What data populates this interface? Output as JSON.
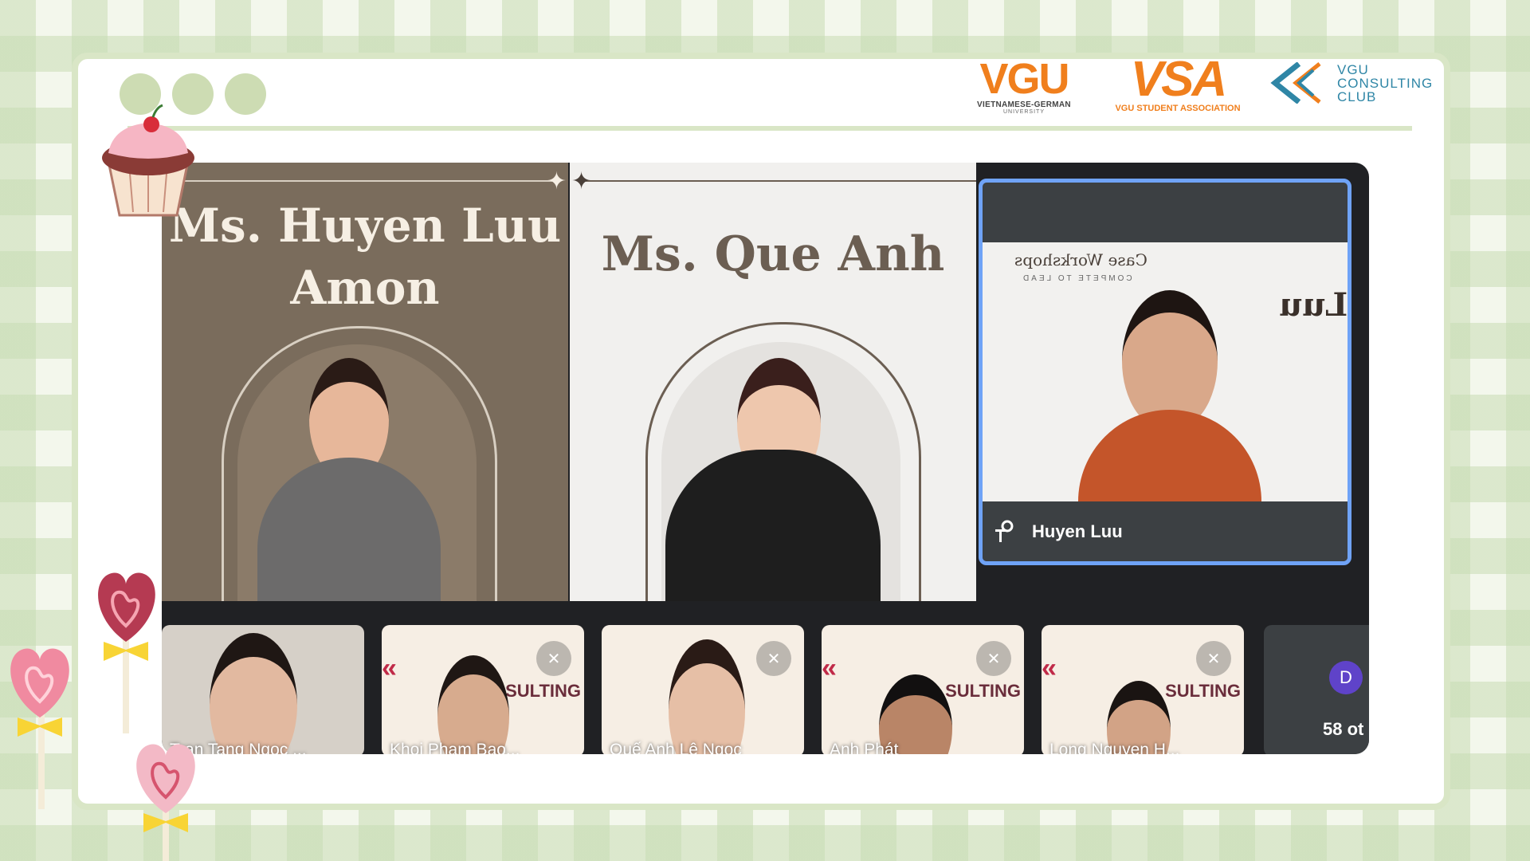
{
  "logos": {
    "vgu": {
      "mark": "VGU",
      "line1": "VIETNAMESE-GERMAN",
      "line2": "UNIVERSITY"
    },
    "vsa": {
      "mark": "VSA",
      "line1": "VGU STUDENT ASSOCIATION"
    },
    "club": {
      "line1": "VGU",
      "line2": "CONSULTING",
      "line3": "CLUB"
    }
  },
  "colors": {
    "accent_orange": "#f07f1d",
    "club_blue": "#2f86a6",
    "frame_green": "#d9e6c6",
    "highlight_blue": "#6fa3f7",
    "avatar_purple": "#5f43c9"
  },
  "speakers": [
    {
      "name_line1": "Ms. Huyen Luu",
      "name_line2": "Amon"
    },
    {
      "name_line1": "Ms. Que Anh"
    }
  ],
  "selected_tile": {
    "mirrored_text1": "Case Workshops",
    "mirrored_text2": "COMPETE TO LEAD",
    "mirrored_text3": "Luu",
    "name": "Huyen Luu",
    "pin_icon": "pin-icon"
  },
  "participants": [
    {
      "label": "Tran Tang Ngoc ...",
      "muted": false
    },
    {
      "label": "Khoi Pham Bao...",
      "muted": true
    },
    {
      "label": "Quế Anh Lê Ngọc",
      "muted": true
    },
    {
      "label": "Anh Phát",
      "muted": true
    },
    {
      "label": "Long Nguyen H...",
      "muted": true
    }
  ],
  "others": {
    "avatar_letter": "D",
    "count_label": "58 ot"
  }
}
